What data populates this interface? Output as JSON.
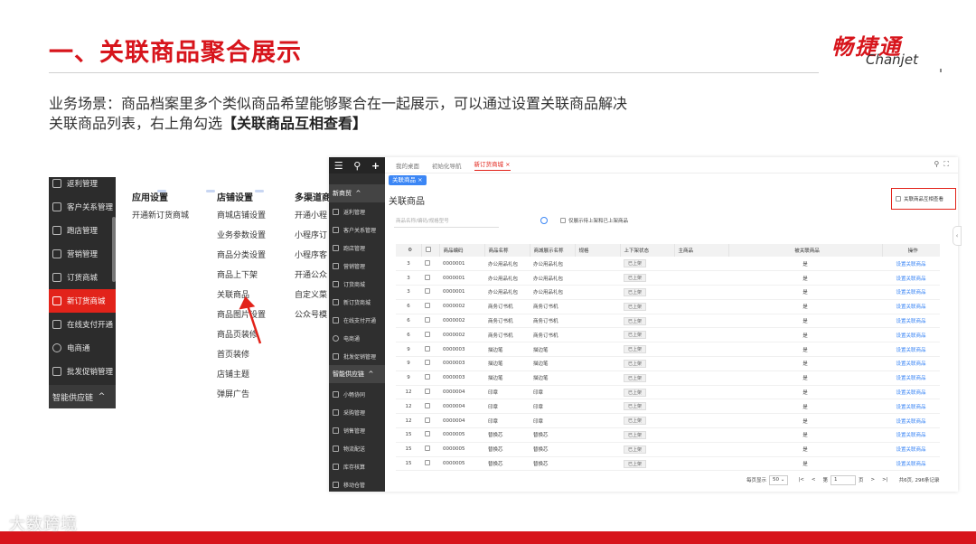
{
  "slide": {
    "title": "一、关联商品聚合展示",
    "desc_line1": "业务场景：商品档案里多个类似商品希望能够聚合在一起展示，可以通过设置关联商品解决",
    "desc_line2_prefix": "关联商品列表，右上角勾选",
    "desc_line2_bold": "【关联商品互相查看】",
    "brand_color": "#d7151c",
    "logo_cn": "畅捷通",
    "logo_en": "Chanjet",
    "watermark": "大数跨境"
  },
  "menu_screenshot": {
    "sidebar_items": [
      {
        "label": "返利管理",
        "icon": "grid-icon"
      },
      {
        "label": "客户关系管理",
        "icon": "grid-icon"
      },
      {
        "label": "跑店管理",
        "icon": "store-icon"
      },
      {
        "label": "营销管理",
        "icon": "chart-icon"
      },
      {
        "label": "订货商城",
        "icon": "shop-icon"
      },
      {
        "label": "新订货商城",
        "icon": "grid-icon",
        "active": true
      },
      {
        "label": "在线支付开通",
        "icon": "grid-icon"
      },
      {
        "label": "电商通",
        "icon": "globe-icon"
      },
      {
        "label": "批发促销管理",
        "icon": "speaker-icon"
      }
    ],
    "sidebar_group": "智能供应链",
    "columns": [
      {
        "heading": "应用设置",
        "links": [
          "开通新订货商城"
        ]
      },
      {
        "heading": "店铺设置",
        "links": [
          "商城店铺设置",
          "业务参数设置",
          "商品分类设置",
          "商品上下架",
          "关联商品",
          "商品图片设置",
          "商品页装修",
          "首页装修",
          "店铺主题",
          "弹屏广告"
        ]
      },
      {
        "heading": "多渠道商",
        "links": [
          "开通小程",
          "小程序订",
          "小程序客",
          "开通公众",
          "自定义菜",
          "公众号模"
        ]
      }
    ]
  },
  "app_screenshot": {
    "sidebar_top_icons": [
      "menu-icon",
      "search-icon",
      "plus-icon"
    ],
    "sidebar_group1": "新商贸",
    "sidebar_items": [
      "返利管理",
      "客户关系管理",
      "跑店管理",
      "营销管理",
      "订货商城",
      "新订货商城",
      "在线支付开通",
      "电商通",
      "批发促销管理"
    ],
    "sidebar_group2": "智能供应链",
    "sidebar_items2": [
      "小畅协同",
      "采购管理",
      "销售管理",
      "物流配送",
      "库存核算",
      "移动仓管"
    ],
    "tabs": [
      "我的桌面",
      "初始化导航",
      "新订货商城"
    ],
    "active_tab": "新订货商城",
    "chip": "关联商品 ×",
    "page_title": "关联商品",
    "mutual_view_label": "关联商品互相查看",
    "search_placeholder": "商品名称/编码/规格型号",
    "filter_label": "仅展示待上架和已上架商品",
    "columns": [
      "",
      "",
      "商品编码",
      "商品名称",
      "商城展示名称",
      "规格",
      "上下架状态",
      "主商品",
      "被关联商品",
      "操作"
    ],
    "rows": [
      {
        "group": "3",
        "code": "0000001",
        "name": "办公用品礼包",
        "display": "办公用品礼包",
        "status": "已上架",
        "related": "是",
        "action": "设置关联商品"
      },
      {
        "group": "3",
        "code": "0000001",
        "name": "办公用品礼包",
        "display": "办公用品礼包",
        "status": "已上架",
        "related": "是",
        "action": "设置关联商品"
      },
      {
        "group": "3",
        "code": "0000001",
        "name": "办公用品礼包",
        "display": "办公用品礼包",
        "status": "已上架",
        "related": "是",
        "action": "设置关联商品"
      },
      {
        "group": "6",
        "code": "0000002",
        "name": "商务订书机",
        "display": "商务订书机",
        "status": "已上架",
        "related": "是",
        "action": "设置关联商品"
      },
      {
        "group": "6",
        "code": "0000002",
        "name": "商务订书机",
        "display": "商务订书机",
        "status": "已上架",
        "related": "是",
        "action": "设置关联商品"
      },
      {
        "group": "6",
        "code": "0000002",
        "name": "商务订书机",
        "display": "商务订书机",
        "status": "已上架",
        "related": "是",
        "action": "设置关联商品"
      },
      {
        "group": "9",
        "code": "0000003",
        "name": "描边笔",
        "display": "描边笔",
        "status": "已上架",
        "related": "是",
        "action": "设置关联商品"
      },
      {
        "group": "9",
        "code": "0000003",
        "name": "描边笔",
        "display": "描边笔",
        "status": "已上架",
        "related": "是",
        "action": "设置关联商品"
      },
      {
        "group": "9",
        "code": "0000003",
        "name": "描边笔",
        "display": "描边笔",
        "status": "已上架",
        "related": "是",
        "action": "设置关联商品"
      },
      {
        "group": "12",
        "code": "0000004",
        "name": "印章",
        "display": "印章",
        "status": "已上架",
        "related": "是",
        "action": "设置关联商品"
      },
      {
        "group": "12",
        "code": "0000004",
        "name": "印章",
        "display": "印章",
        "status": "已上架",
        "related": "是",
        "action": "设置关联商品"
      },
      {
        "group": "12",
        "code": "0000004",
        "name": "印章",
        "display": "印章",
        "status": "已上架",
        "related": "是",
        "action": "设置关联商品"
      },
      {
        "group": "15",
        "code": "0000005",
        "name": "替换芯",
        "display": "替换芯",
        "status": "已上架",
        "related": "是",
        "action": "设置关联商品"
      },
      {
        "group": "15",
        "code": "0000005",
        "name": "替换芯",
        "display": "替换芯",
        "status": "已上架",
        "related": "是",
        "action": "设置关联商品"
      },
      {
        "group": "15",
        "code": "0000005",
        "name": "替换芯",
        "display": "替换芯",
        "status": "已上架",
        "related": "是",
        "action": "设置关联商品"
      }
    ],
    "pager": {
      "per_page_label": "每页显示",
      "per_page": "50",
      "page_prefix": "第",
      "page": "1",
      "page_suffix": "页",
      "summary": "共6页, 296条记录"
    }
  }
}
